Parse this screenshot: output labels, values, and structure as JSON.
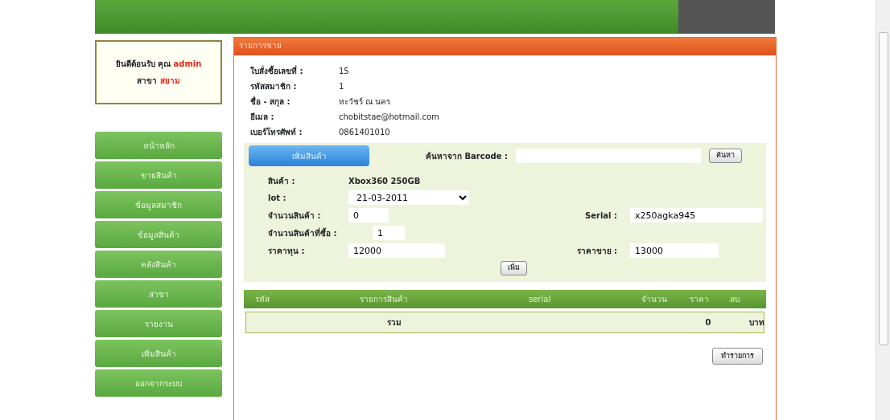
{
  "welcome": {
    "greeting": "ยินดีต้อนรับ คุณ",
    "user": "admin",
    "branch_label": "สาขา",
    "branch": "สยาม"
  },
  "menu": [
    {
      "label": "หน้าหลัก"
    },
    {
      "label": "ขายสินค้า"
    },
    {
      "label": "ข้อมูลสมาชิก"
    },
    {
      "label": "ข้อมูลสินค้า"
    },
    {
      "label": "คลังสินค้า"
    },
    {
      "label": "สาขา"
    },
    {
      "label": "รายงาน"
    },
    {
      "label": "เพิ่มสินค้า"
    },
    {
      "label": "ออกจากระบบ"
    }
  ],
  "panel": {
    "title": "รายการขาย",
    "info": [
      {
        "label": "ใบสั่งซื้อเลขที่ :",
        "value": "15"
      },
      {
        "label": "รหัสสมาชิก :",
        "value": "1"
      },
      {
        "label": "ชื่อ - สกุล :",
        "value": "หะวัชร์ ณ นคร"
      },
      {
        "label": "อีเมล :",
        "value": "chobitstae@hotmail.com"
      },
      {
        "label": "เบอร์โทรศัพท์ :",
        "value": "0861401010"
      }
    ],
    "add_product_button": "เพิ่มสินค้า",
    "barcode_label": "ค้นหาจาก Barcode :",
    "search_button": "ค้นหา",
    "product_label": "สินค้า :",
    "product": "Xbox360 250GB",
    "lot_label": "lot :",
    "lot": "21-03-2011",
    "stock_label": "จำนวนสินค้า :",
    "stock": "0",
    "serial_label": "Serial :",
    "serial": "x250agka945",
    "qty_label": "จำนวนสินค้าที่ซื้อ :",
    "qty": "1",
    "cost_label": "ราคาทุน :",
    "cost": "12000",
    "price_label": "ราคาขาย :",
    "price": "13000",
    "add_button": "เพิ่ม",
    "table": {
      "columns": [
        "รหัส",
        "รายการสินค้า",
        "serial",
        "จำนวน",
        "ราคา",
        "ลบ"
      ],
      "total": {
        "label": "รวม",
        "amount": "0",
        "unit": "บาท"
      }
    },
    "submit_button": "ทำรายการ"
  }
}
